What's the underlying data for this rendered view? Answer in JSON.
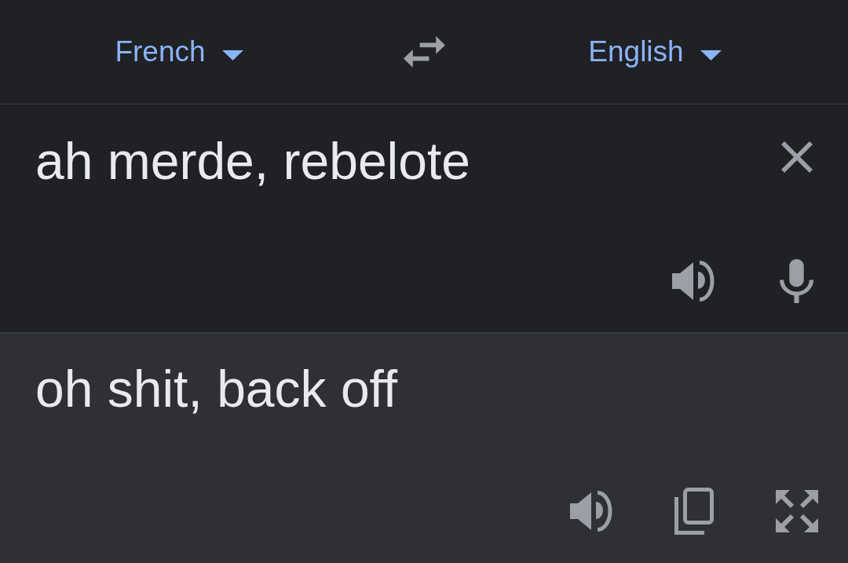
{
  "language_bar": {
    "source_language": "French",
    "target_language": "English"
  },
  "source": {
    "value": "ah merde, rebelote"
  },
  "translation": {
    "text": "oh shit, back off"
  }
}
